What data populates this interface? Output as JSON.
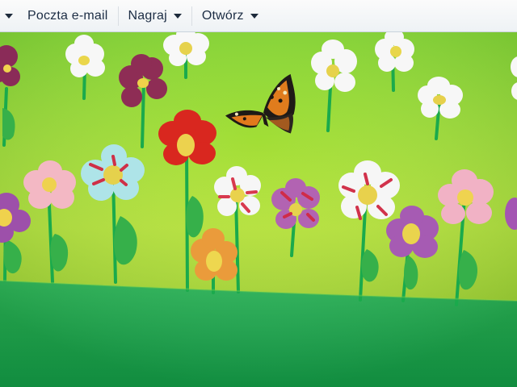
{
  "toolbar": {
    "items": [
      {
        "label": "Poczta e-mail",
        "has_dropdown": false
      },
      {
        "label": "Nagraj",
        "has_dropdown": true
      },
      {
        "label": "Otwórz",
        "has_dropdown": true
      }
    ],
    "lead_dropdown_icon": "chevron-down-icon"
  },
  "picture": {
    "description": "photo-viewer image preview",
    "sky_color": "#b6d82f",
    "lawn_color": "#18a953",
    "ground_color": "#0e9a49",
    "stem_color": "#18b64c",
    "leaf_color": "#3ab448",
    "butterfly_colors": [
      "#e27b1b",
      "#1d1a17",
      "#f0e6b8"
    ]
  }
}
